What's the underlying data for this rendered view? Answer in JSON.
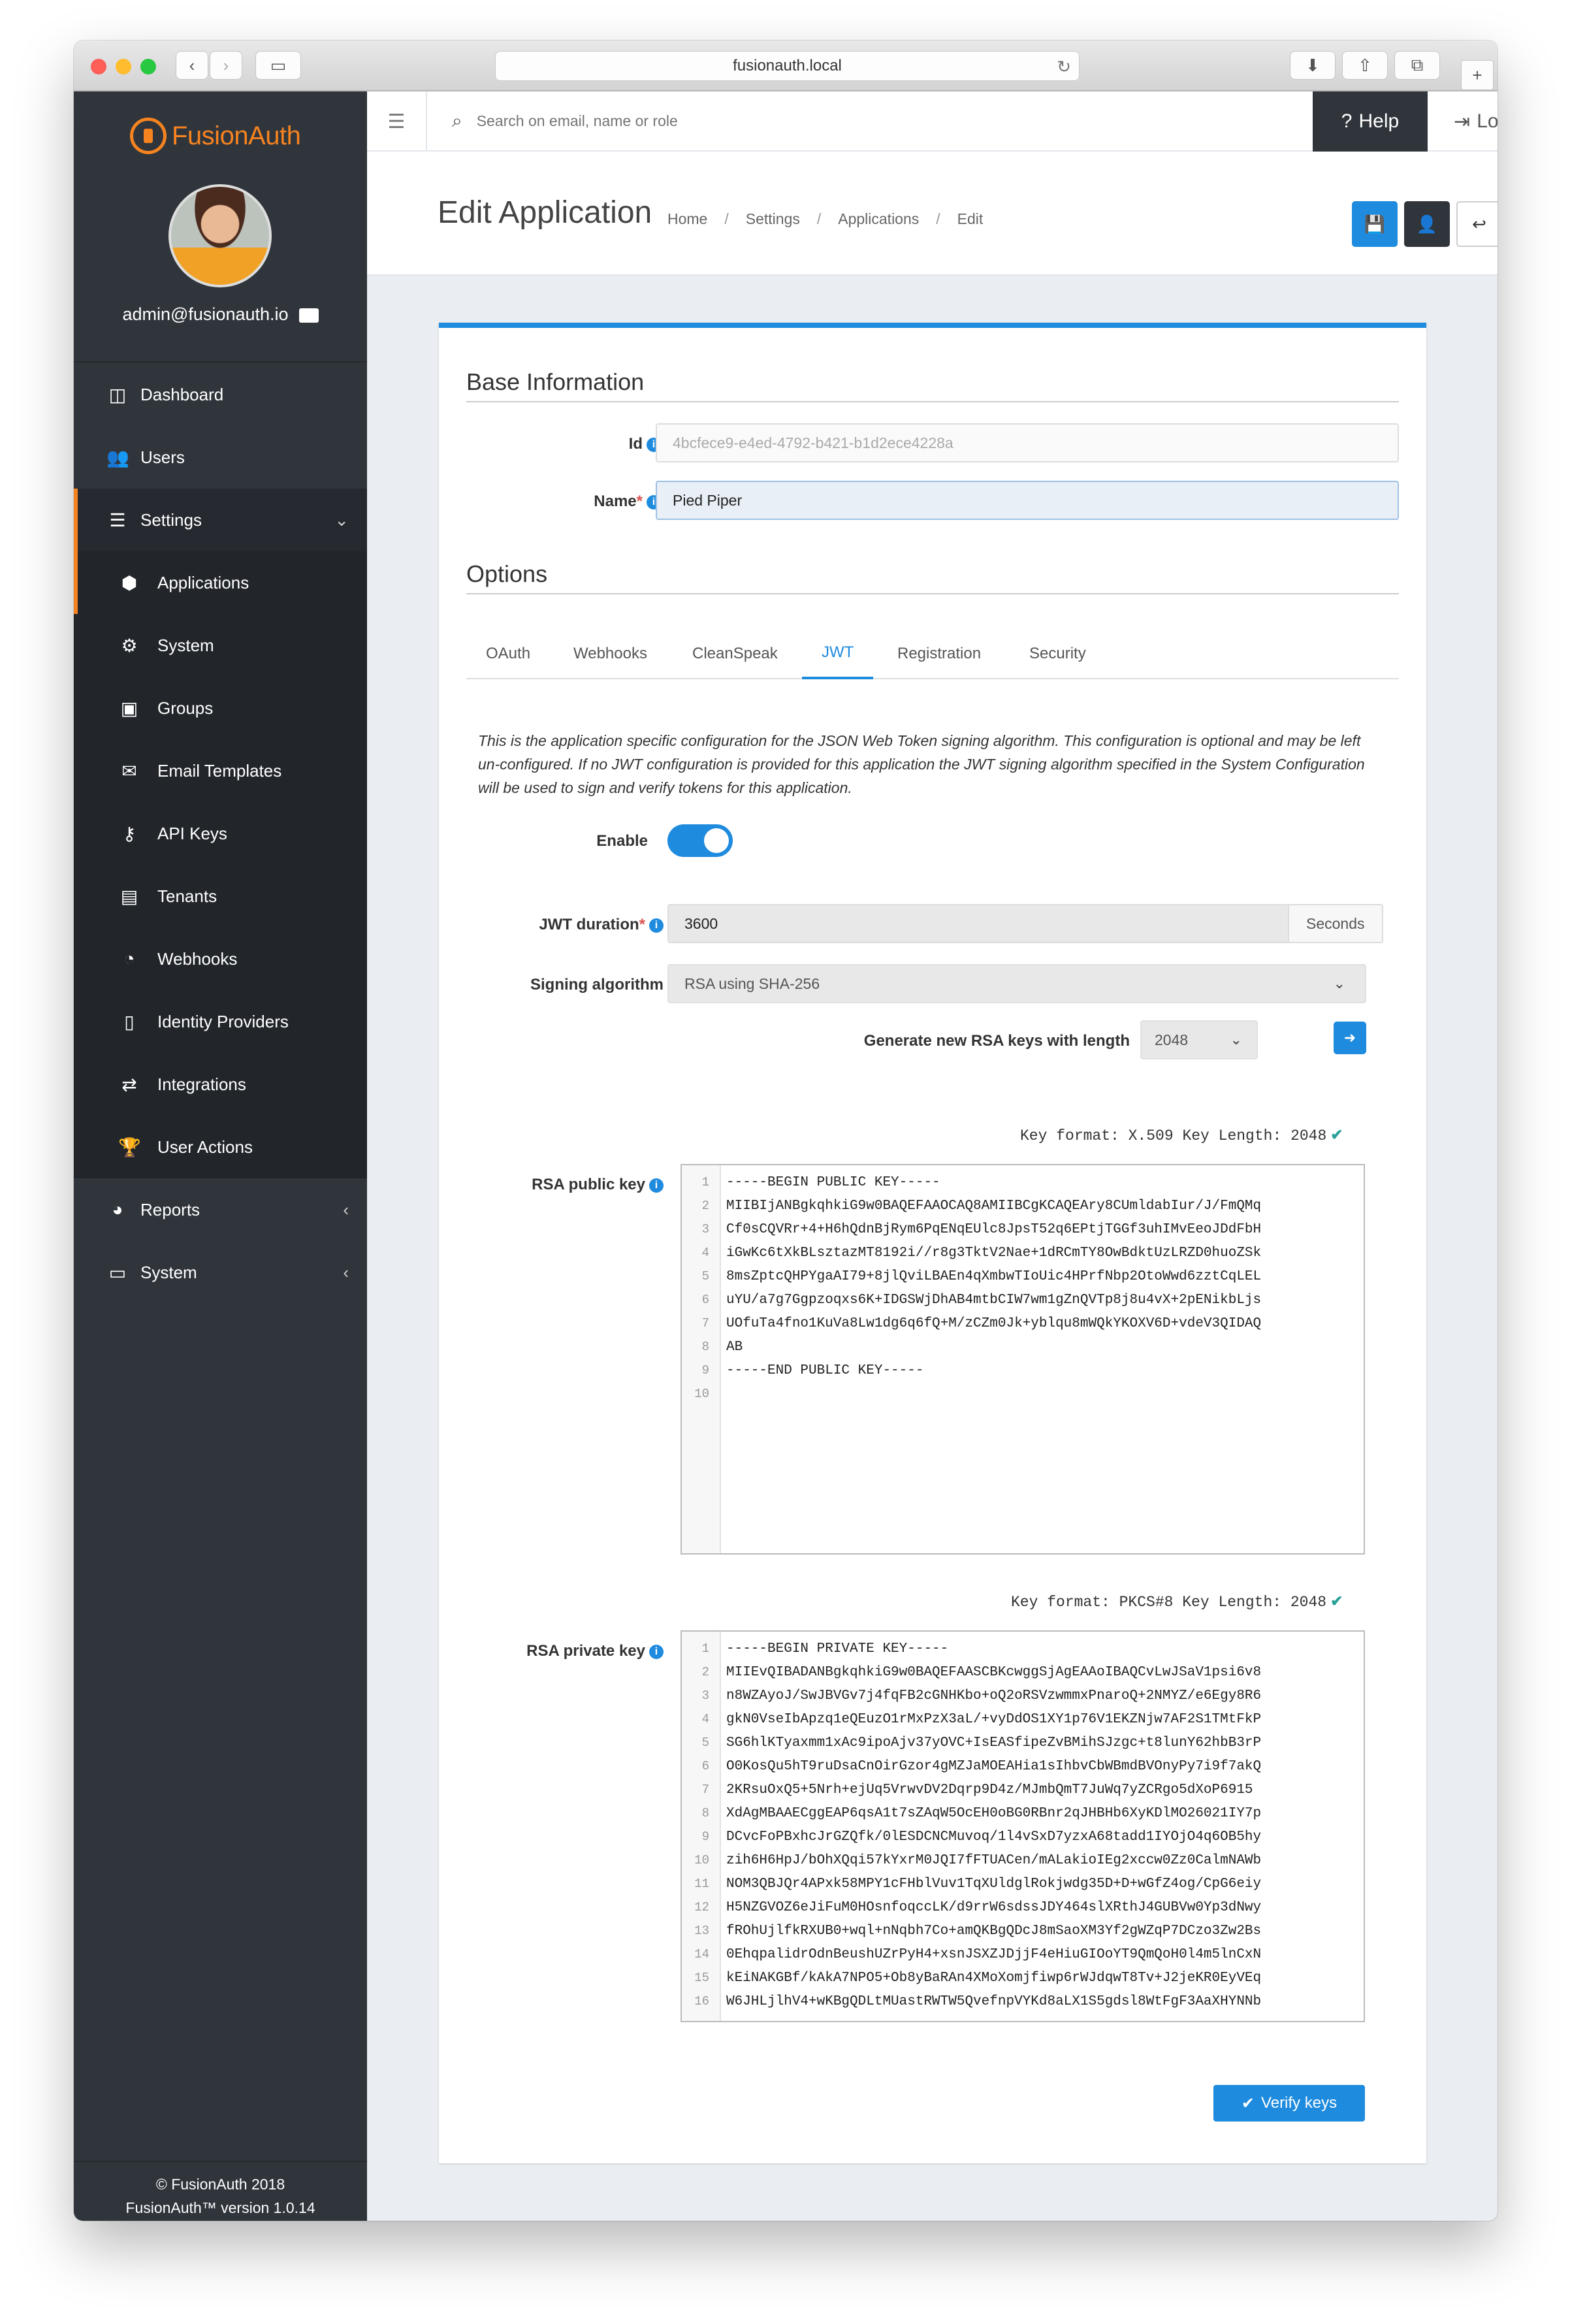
{
  "browser": {
    "url": "fusionauth.local"
  },
  "sidebar": {
    "logo": "FusionAuth",
    "user": "admin@fusionauth.io",
    "items": [
      {
        "label": "Dashboard",
        "icon": "columns-icon"
      },
      {
        "label": "Users",
        "icon": "users-icon"
      },
      {
        "label": "Settings",
        "icon": "sliders-icon"
      },
      {
        "label": "Applications",
        "icon": "cube-icon"
      },
      {
        "label": "System",
        "icon": "gear-icon"
      },
      {
        "label": "Groups",
        "icon": "groups-icon"
      },
      {
        "label": "Email Templates",
        "icon": "envelope-icon"
      },
      {
        "label": "API Keys",
        "icon": "key-icon"
      },
      {
        "label": "Tenants",
        "icon": "building-icon"
      },
      {
        "label": "Webhooks",
        "icon": "rss-icon"
      },
      {
        "label": "Identity Providers",
        "icon": "id-badge-icon"
      },
      {
        "label": "Integrations",
        "icon": "exchange-icon"
      },
      {
        "label": "User Actions",
        "icon": "trophy-icon"
      },
      {
        "label": "Reports",
        "icon": "pie-chart-icon"
      },
      {
        "label": "System",
        "icon": "monitor-icon"
      }
    ],
    "footer_line1": "© FusionAuth 2018",
    "footer_line2": "FusionAuth™ version 1.0.14"
  },
  "topbar": {
    "search_placeholder": "Search on email, name or role",
    "help": "Help",
    "logout": "Logout"
  },
  "header": {
    "title": "Edit Application",
    "breadcrumbs": [
      "Home",
      "Settings",
      "Applications",
      "Edit"
    ]
  },
  "form": {
    "base_title": "Base Information",
    "id_label": "Id",
    "id_value": "4bcfece9-e4ed-4792-b421-b1d2ece4228a",
    "name_label": "Name",
    "name_value": "Pied Piper",
    "options_title": "Options",
    "tabs": [
      "OAuth",
      "Webhooks",
      "CleanSpeak",
      "JWT",
      "Registration",
      "Security"
    ],
    "active_tab": "JWT",
    "description": "This is the application specific configuration for the JSON Web Token signing algorithm. This configuration is optional and may be left un-configured. If no JWT configuration is provided for this application the JWT signing algorithm specified in the System Configuration will be used to sign and verify tokens for this application.",
    "enable_label": "Enable",
    "enabled": true,
    "duration_label": "JWT duration",
    "duration_value": "3600",
    "duration_unit": "Seconds",
    "signing_label": "Signing algorithm",
    "signing_value": "RSA using SHA-256",
    "generate_label": "Generate new RSA keys with length",
    "generate_value": "2048",
    "public_key_label": "RSA public key",
    "public_key_format": "Key format: X.509 Key Length: 2048",
    "public_key_lines": [
      "-----BEGIN PUBLIC KEY-----",
      "MIIBIjANBgkqhkiG9w0BAQEFAAOCAQ8AMIIBCgKCAQEAry8CUmldabIur/J/FmQMq",
      "Cf0sCQVRr+4+H6hQdnBjRym6PqENqEUlc8JpsT52q6EPtjTGGf3uhIMvEeoJDdFbH",
      "iGwKc6tXkBLsztazMT8192i//r8g3TktV2Nae+1dRCmTY8OwBdktUzLRZD0huoZSk",
      "8msZptcQHPYgaAI79+8jlQviLBAEn4qXmbwTIoUic4HPrfNbp2OtoWwd6zztCqLEL",
      "uYU/a7g7Ggpzoqxs6K+IDGSWjDhAB4mtbCIW7wm1gZnQVTp8j8u4vX+2pENikbLjs",
      "UOfuTa4fno1KuVa8Lw1dg6q6fQ+M/zCZm0Jk+yblqu8mWQkYKOXV6D+vdeV3QIDAQ",
      "AB",
      "-----END PUBLIC KEY-----",
      ""
    ],
    "private_key_label": "RSA private key",
    "private_key_format": "Key format: PKCS#8 Key Length: 2048",
    "private_key_lines": [
      "-----BEGIN PRIVATE KEY-----",
      "MIIEvQIBADANBgkqhkiG9w0BAQEFAASCBKcwggSjAgEAAoIBAQCvLwJSaV1psi6v8",
      "n8WZAyoJ/SwJBVGv7j4fqFB2cGNHKbo+oQ2oRSVzwmmxPnaroQ+2NMYZ/e6Egy8R6",
      "gkN0VseIbApzq1eQEuzO1rMxPzX3aL/+vyDdOS1XY1p76V1EKZNjw7AF2S1TMtFkP",
      "SG6hlKTyaxmm1xAc9ipoAjv37yOVC+IsEASfipeZvBMihSJzgc+t8lunY62hbB3rP",
      "O0KosQu5hT9ruDsaCnOirGzor4gMZJaMOEAHia1sIhbvCbWBmdBVOnyPy7i9f7akQ",
      "2KRsuOxQ5+5Nrh+ejUq5VrwvDV2Dqrp9D4z/MJmbQmT7JuWq7yZCRgo5dXoP6915",
      "XdAgMBAAECggEAP6qsA1t7sZAqW5OcEH0oBG0RBnr2qJHBHb6XyKDlMO26021IY7p",
      "DCvcFoPBxhcJrGZQfk/0lESDCNCMuvoq/1l4vSxD7yzxA68tadd1IYOjO4q6OB5hy",
      "zih6H6HpJ/bOhXQqi57kYxrM0JQI7fFTUACen/mALakioIEg2xccw0Zz0CalmNAWb",
      "NOM3QBJQr4APxk58MPY1cFHblVuv1TqXUldglRokjwdg35D+D+wGfZ4og/CpG6eiy",
      "H5NZGVOZ6eJiFuM0HOsnfoqccLK/d9rrW6sdssJDY464slXRthJ4GUBVw0Yp3dNwy",
      "fROhUjlfkRXUB0+wql+nNqbh7Co+amQKBgQDcJ8mSaoXM3Yf2gWZqP7DCzo3Zw2Bs",
      "0EhqpalidrOdnBeushUZrPyH4+xsnJSXZJDjjF4eHiuGIOoYT9QmQoH0l4m5lnCxN",
      "kEiNAKGBf/kAkA7NPO5+Ob8yBaRAn4XMoXomjfiwp6rWJdqwT8Tv+J2jeKR0EyVEq",
      "W6JHLjlhV4+wKBgQDLtMUastRWTW5QvefnpVYKd8aLX1S5gdsl8WtFgF3AaXHYNNb"
    ],
    "verify_button": "Verify keys"
  },
  "colors": {
    "accent": "#1f8bde",
    "brand": "#f58320",
    "sidebar": "#30353c"
  }
}
